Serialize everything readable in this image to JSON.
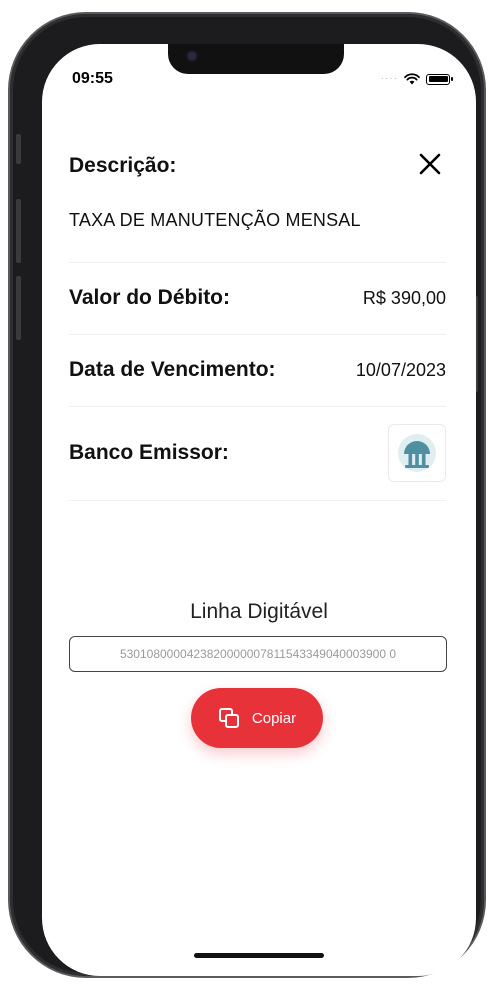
{
  "status_bar": {
    "time": "09:55"
  },
  "details": {
    "descricao_label": "Descrição:",
    "descricao_value": "TAXA DE MANUTENÇÃO MENSAL",
    "valor_label": "Valor do Débito:",
    "valor_value": "R$ 390,00",
    "vencimento_label": "Data de Vencimento:",
    "vencimento_value": "10/07/2023",
    "banco_label": "Banco Emissor:"
  },
  "linha_digitavel": {
    "title": "Linha Digitável",
    "value": "5301080000423820000007811543349040003900 0"
  },
  "actions": {
    "copy_label": "Copiar"
  },
  "colors": {
    "accent_red": "#e8323a",
    "bank_logo_teal": "#4f8fa0"
  }
}
